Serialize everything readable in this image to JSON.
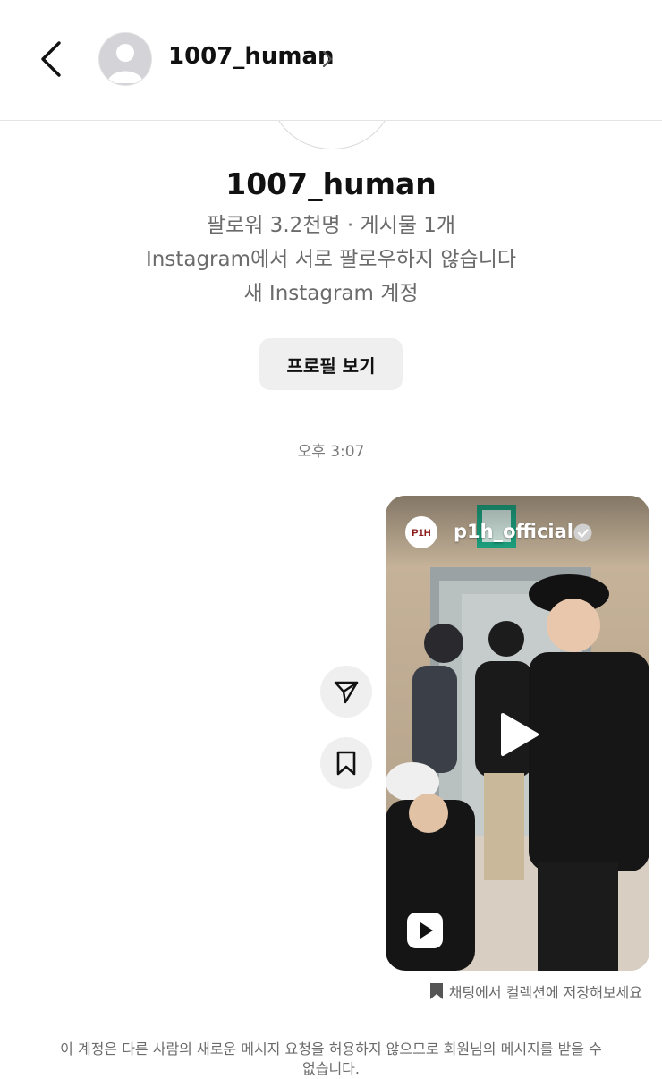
{
  "header": {
    "username": "1007_human",
    "back_icon": "chevron-left-icon",
    "open_icon": "chevron-right-icon"
  },
  "profile": {
    "username": "1007_human",
    "stats": "팔로워 3.2천명 · 게시물 1개",
    "relationship": "Instagram에서 서로 팔로우하지 않습니다",
    "account_note": "새 Instagram 계정",
    "view_profile_label": "프로필 보기"
  },
  "thread": {
    "timestamp": "오후 3:07"
  },
  "shared_reel": {
    "account": "p1h_official",
    "account_logo_text": "P1H",
    "verified": true,
    "media_type": "reel"
  },
  "actions": {
    "share_icon": "send-icon",
    "save_icon": "bookmark-icon"
  },
  "save_hint": "채팅에서 컬렉션에 저장해보세요",
  "footer_notice": "이 계정은 다른 사람의 새로운 메시지 요청을 허용하지 않으므로 회원님의 메시지를 받을 수 없습니다.",
  "colors": {
    "secondary_text": "#6b6b6b",
    "button_bg": "#efefef",
    "verified_badge": "#d0d0d0",
    "logo_red": "#8b1a1a"
  }
}
